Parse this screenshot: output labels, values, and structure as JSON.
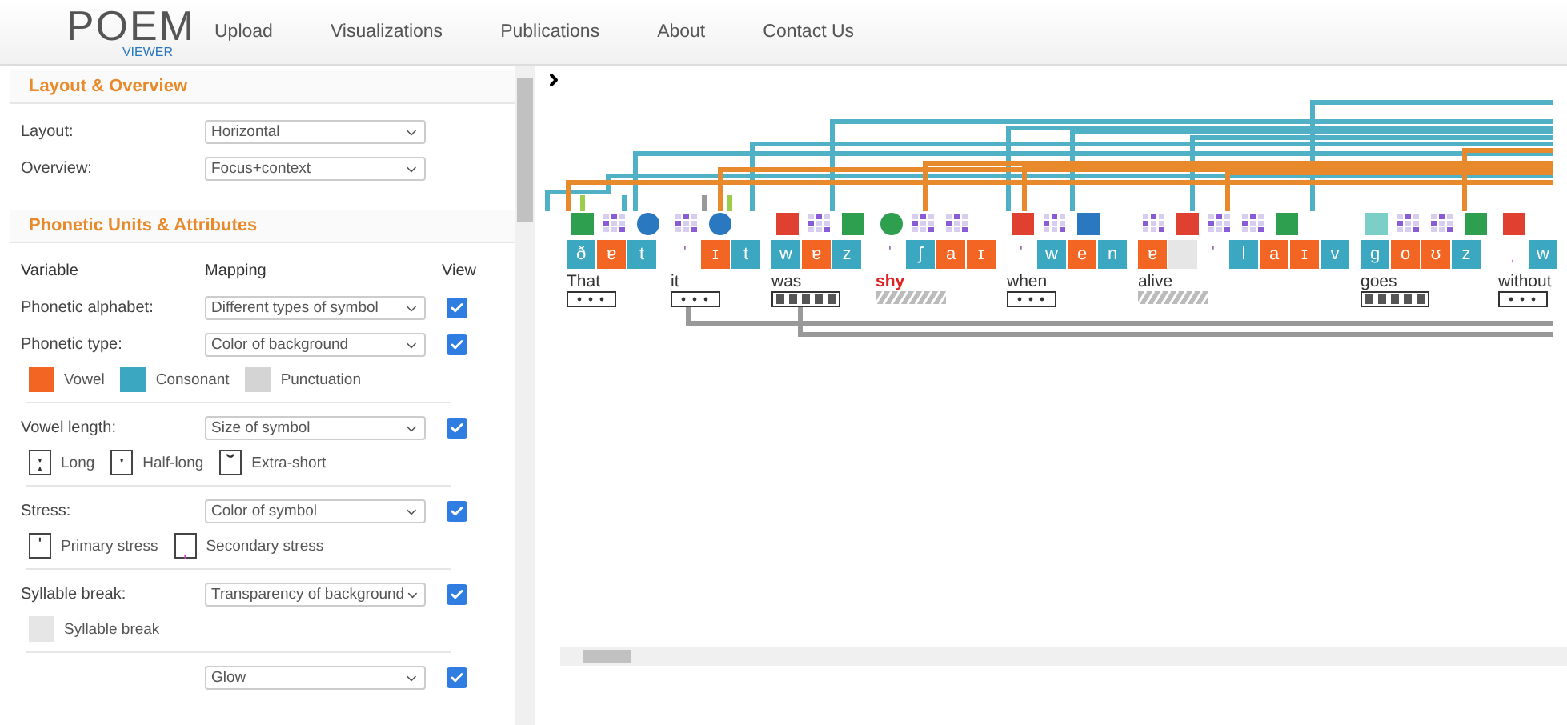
{
  "logo": {
    "main": "POEM",
    "sub": "VIEWER"
  },
  "nav": [
    "Upload",
    "Visualizations",
    "Publications",
    "About",
    "Contact Us"
  ],
  "layout_section": {
    "title": "Layout & Overview",
    "rows": [
      {
        "label": "Layout:",
        "value": "Horizontal"
      },
      {
        "label": "Overview:",
        "value": "Focus+context"
      }
    ]
  },
  "phonetic_section": {
    "title": "Phonetic Units & Attributes",
    "columns": [
      "Variable",
      "Mapping",
      "View"
    ],
    "variables": [
      {
        "label": "Phonetic alphabet:",
        "mapping": "Different types of symbol",
        "checked": true
      },
      {
        "label": "Phonetic type:",
        "mapping": "Color of background",
        "checked": true,
        "legend": [
          {
            "kind": "swatch",
            "color": "#f26522",
            "label": "Vowel"
          },
          {
            "kind": "swatch",
            "color": "#3ba7c0",
            "label": "Consonant"
          },
          {
            "kind": "swatch",
            "color": "#d4d4d4",
            "label": "Punctuation"
          }
        ]
      },
      {
        "label": "Vowel length:",
        "mapping": "Size of symbol",
        "checked": true,
        "legend": [
          {
            "kind": "symbol",
            "symbol": "ː",
            "label": "Long"
          },
          {
            "kind": "symbol",
            "symbol": "ˑ",
            "label": "Half-long"
          },
          {
            "kind": "symbol",
            "symbol": "˘",
            "label": "Extra-short"
          }
        ]
      },
      {
        "label": "Stress:",
        "mapping": "Color of symbol",
        "checked": true,
        "legend": [
          {
            "kind": "symbol",
            "symbol": "ˈ",
            "label": "Primary stress"
          },
          {
            "kind": "symbol",
            "symbol": "ˌ",
            "color": "#d040d0",
            "label": "Secondary stress"
          }
        ]
      },
      {
        "label": "Syllable break:",
        "mapping": "Transparency of background",
        "checked": true,
        "legend": [
          {
            "kind": "swatch",
            "color": "#e6e6e6",
            "label": "Syllable break"
          }
        ]
      },
      {
        "mapping": "Glow",
        "checked": true
      }
    ]
  },
  "words": [
    {
      "text": "That",
      "highlighted": false,
      "meter": {
        "kind": "dots"
      },
      "markers": [
        {
          "kind": "square",
          "color": "#2e9e4f"
        },
        {
          "kind": "grid"
        },
        {
          "kind": "circle",
          "color": "#2a78c0"
        }
      ],
      "phonemes": [
        {
          "symbol": "ð",
          "kind": "consonant"
        },
        {
          "symbol": "ɐ",
          "kind": "vowel"
        },
        {
          "symbol": "t",
          "kind": "consonant"
        }
      ]
    },
    {
      "text": "it",
      "highlighted": false,
      "meter": {
        "kind": "dots"
      },
      "markers": [
        {
          "kind": "grid"
        },
        {
          "kind": "circle",
          "color": "#2a78c0"
        }
      ],
      "phonemes": [
        {
          "symbol": "ˈ",
          "kind": "stress"
        },
        {
          "symbol": "ɪ",
          "kind": "vowel"
        },
        {
          "symbol": "t",
          "kind": "consonant"
        }
      ]
    },
    {
      "text": "was",
      "highlighted": false,
      "meter": {
        "kind": "bars"
      },
      "markers": [
        {
          "kind": "square",
          "color": "#e04030"
        },
        {
          "kind": "grid"
        },
        {
          "kind": "square",
          "color": "#2e9e4f"
        }
      ],
      "phonemes": [
        {
          "symbol": "w",
          "kind": "consonant"
        },
        {
          "symbol": "ɐ",
          "kind": "vowel"
        },
        {
          "symbol": "z",
          "kind": "consonant"
        }
      ]
    },
    {
      "text": "shy",
      "highlighted": true,
      "meter": {
        "kind": "hatched"
      },
      "markers": [
        {
          "kind": "circle",
          "color": "#2e9e4f"
        },
        {
          "kind": "grid"
        },
        {
          "kind": "grid"
        }
      ],
      "phonemes": [
        {
          "symbol": "ˈ",
          "kind": "stress"
        },
        {
          "symbol": "ʃ",
          "kind": "consonant"
        },
        {
          "symbol": "a",
          "kind": "vowel"
        },
        {
          "symbol": "ɪ",
          "kind": "vowel"
        }
      ]
    },
    {
      "text": "when",
      "highlighted": false,
      "meter": {
        "kind": "dots"
      },
      "markers": [
        {
          "kind": "square",
          "color": "#e04030"
        },
        {
          "kind": "grid"
        },
        {
          "kind": "square",
          "color": "#2a78c0"
        }
      ],
      "phonemes": [
        {
          "symbol": "ˈ",
          "kind": "stress"
        },
        {
          "symbol": "w",
          "kind": "consonant"
        },
        {
          "symbol": "e",
          "kind": "vowel"
        },
        {
          "symbol": "n",
          "kind": "consonant"
        }
      ]
    },
    {
      "text": "alive",
      "highlighted": false,
      "meter": {
        "kind": "hatched"
      },
      "markers": [
        {
          "kind": "grid"
        },
        {
          "kind": "square",
          "color": "#e04030"
        },
        {
          "kind": "grid"
        },
        {
          "kind": "grid"
        },
        {
          "kind": "square",
          "color": "#2e9e4f"
        }
      ],
      "phonemes": [
        {
          "symbol": "ɐ",
          "kind": "vowel"
        },
        {
          "kind": "break"
        },
        {
          "symbol": "ˈ",
          "kind": "stress"
        },
        {
          "symbol": "l",
          "kind": "consonant"
        },
        {
          "symbol": "a",
          "kind": "vowel"
        },
        {
          "symbol": "ɪ",
          "kind": "vowel"
        },
        {
          "symbol": "v",
          "kind": "consonant"
        }
      ]
    },
    {
      "text": "goes",
      "highlighted": false,
      "meter": {
        "kind": "bars"
      },
      "markers": [
        {
          "kind": "square",
          "color": "#7ccfc6"
        },
        {
          "kind": "grid"
        },
        {
          "kind": "grid"
        },
        {
          "kind": "square",
          "color": "#2e9e4f"
        }
      ],
      "phonemes": [
        {
          "symbol": "g",
          "kind": "consonant"
        },
        {
          "symbol": "o",
          "kind": "vowel"
        },
        {
          "symbol": "ʊ",
          "kind": "vowel"
        },
        {
          "symbol": "z",
          "kind": "consonant"
        }
      ]
    },
    {
      "text": "without",
      "highlighted": false,
      "meter": {
        "kind": "dots"
      },
      "markers": [
        {
          "kind": "square",
          "color": "#e04030"
        }
      ],
      "phonemes": [
        {
          "symbol": "ˌ",
          "kind": "stress2"
        },
        {
          "symbol": "w",
          "kind": "consonant"
        }
      ]
    }
  ]
}
